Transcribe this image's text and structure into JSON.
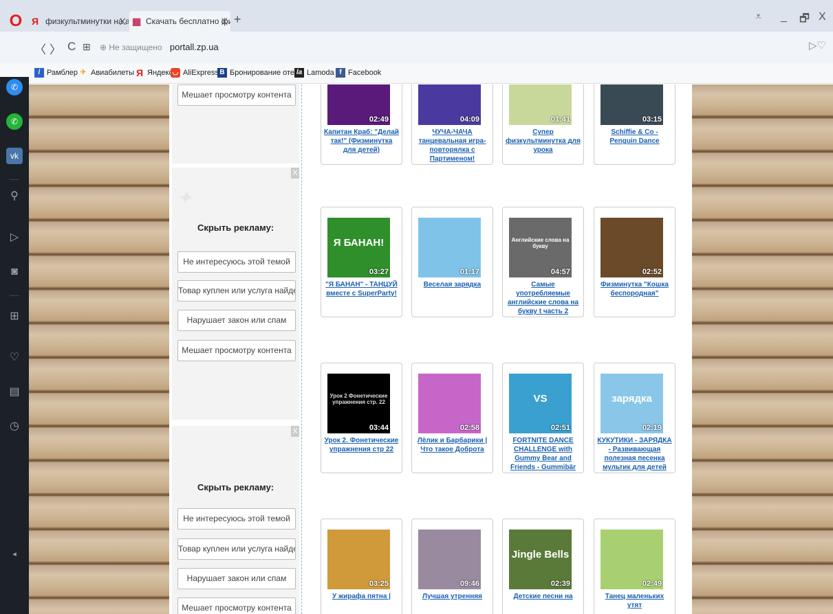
{
  "browser": {
    "tabs": [
      {
        "label": "физкультминутки на анг",
        "close": "X"
      },
      {
        "label": "Скачать бесплатно физку",
        "close": "X"
      }
    ],
    "new_tab": "+",
    "window_controls": [
      "⩡",
      "_",
      "🗗",
      "X"
    ],
    "nav": {
      "back": "〈",
      "forward": "〉",
      "reload": "C",
      "speed_dial": "⊞"
    },
    "url": {
      "security": "⊕ Не защищено",
      "domain": "portall.zp.ua"
    },
    "addr_right": "▷♡",
    "bookmarks": [
      {
        "label": "Рамблер",
        "icon": "rambler-icon",
        "color": "#2a62c9"
      },
      {
        "label": "Авиабилеты",
        "icon": "plane-icon",
        "color": "#f0a020"
      },
      {
        "label": "Яндекс",
        "icon": "yandex-icon",
        "color": "#e2201c"
      },
      {
        "label": "AliExpress",
        "icon": "aliexpress-icon",
        "color": "#e8442a"
      },
      {
        "label": "Бронирование отел",
        "icon": "booking-icon",
        "color": "#1d3f8c"
      },
      {
        "label": "Lamoda",
        "icon": "lamoda-icon",
        "color": "#222"
      },
      {
        "label": "Facebook",
        "icon": "facebook-icon",
        "color": "#3b5998"
      }
    ]
  },
  "ads": {
    "top_button": "Мешает просмотру контента",
    "hide_title": "Скрыть рекламу:",
    "close": "X",
    "options": [
      "Не интересуюсь этой темой",
      "Товар куплен или услуга найдена",
      "Нарушает закон или спам",
      "Мешает просмотру контента"
    ]
  },
  "videos": [
    {
      "title": "Капитан Краб: \"Делай так!\" (Физминутка для детей)",
      "duration": "02:49",
      "bg": "#5a1a7a",
      "text": ""
    },
    {
      "title": "ЧУЧА-ЧАЧА танцевальная игра-повторялка с Партименом!",
      "duration": "04:09",
      "bg": "#4a3aa0",
      "text": ""
    },
    {
      "title": "Супер физкультминутка для урока",
      "duration": "01:41",
      "bg": "#c8d89a",
      "text": ""
    },
    {
      "title": "Schiffie & Co - Penguin Dance",
      "duration": "03:15",
      "bg": "#3a4a55",
      "text": ""
    },
    {
      "title": "\"Я БАНАН\" - ТАНЦУЙ вместе с SuperParty!",
      "duration": "03:27",
      "bg": "#2f8f2a",
      "text": "Я БАНАН!"
    },
    {
      "title": "Веселая зарядка",
      "duration": "01:17",
      "bg": "#7fc4e8",
      "text": ""
    },
    {
      "title": "Самые употребляемые английские слова на букву t часть 2",
      "duration": "04:57",
      "bg": "#6a6a6a",
      "text": "Английские слова на букву"
    },
    {
      "title": "Физминутка \"Кошка беспородная\"",
      "duration": "02:52",
      "bg": "#6b4a2a",
      "text": ""
    },
    {
      "title": "Урок 2. Фонетические упражнения стр 22",
      "duration": "03:44",
      "bg": "#000000",
      "text": "Урок 2 Фонетические упражнения стр. 22"
    },
    {
      "title": "Лёлик и Барбарики | Что такое Доброта",
      "duration": "02:58",
      "bg": "#c766c9",
      "text": ""
    },
    {
      "title": "FORTNITE DANCE CHALLENGE with Gummy Bear and Friends - Gummibär",
      "duration": "02:51",
      "bg": "#3aa0d0",
      "text": "VS"
    },
    {
      "title": "КУКУТИКИ - ЗАРЯДКА - Развивающая полезная песенка мультик для детей малышей",
      "duration": "02:19",
      "bg": "#8ac6e8",
      "text": "зарядка"
    },
    {
      "title": "У жирафа пятна |",
      "duration": "03:25",
      "bg": "#d09a3a",
      "text": ""
    },
    {
      "title": "Лучшая утренняя",
      "duration": "09:46",
      "bg": "#9a8aa0",
      "text": ""
    },
    {
      "title": "Детские песни на",
      "duration": "02:39",
      "bg": "#5a7a3a",
      "text": "Jingle Bells"
    },
    {
      "title": "Танец маленьких утят",
      "duration": "02:49",
      "bg": "#a8d070",
      "text": ""
    }
  ]
}
